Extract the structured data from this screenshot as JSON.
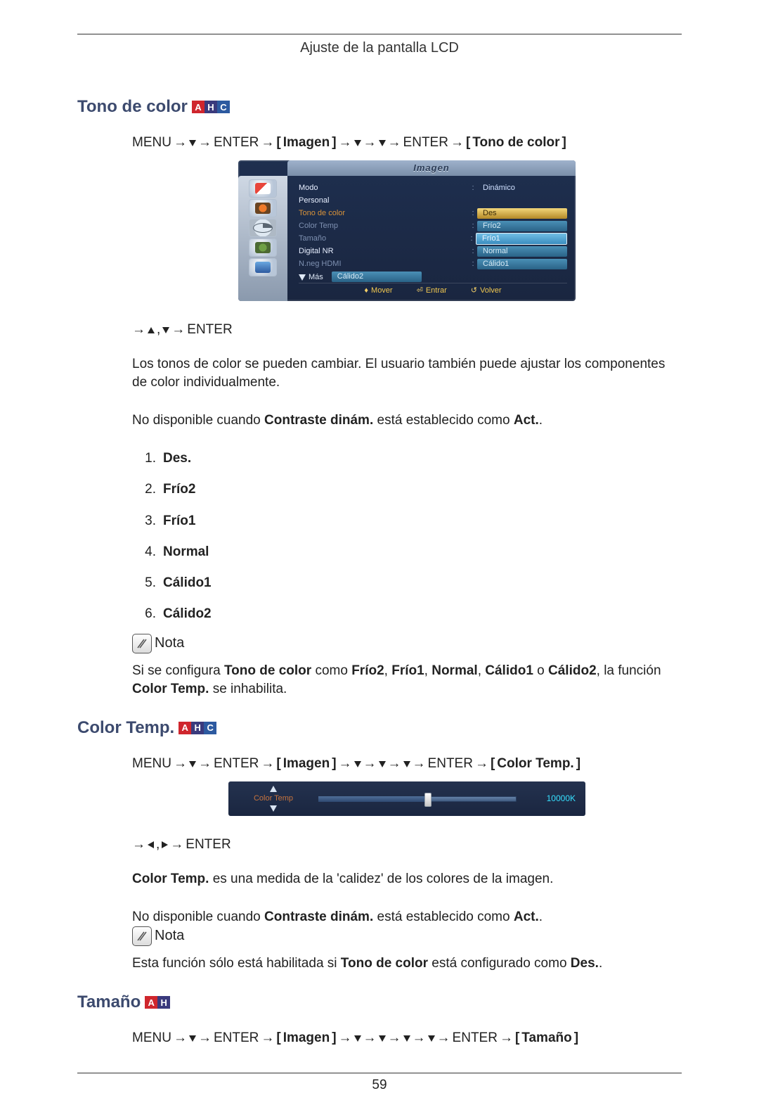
{
  "header": {
    "title": "Ajuste de la pantalla LCD"
  },
  "page_number": "59",
  "badges": {
    "a": "A",
    "h": "H",
    "c": "C"
  },
  "sec_tono": {
    "heading": "Tono de color",
    "menu": {
      "menu": "MENU",
      "enter": "ENTER",
      "imagen": "Imagen",
      "target": "Tono de color"
    },
    "osd": {
      "title": "Imagen",
      "rows": {
        "modo": {
          "label": "Modo",
          "value": "Dinámico"
        },
        "personal": {
          "label": "Personal"
        },
        "tono": {
          "label": "Tono de color",
          "value": "Des"
        },
        "ctemp": {
          "label": "Color Temp",
          "value": "Frío2"
        },
        "tam": {
          "label": "Tamaño",
          "value": "Frío1"
        },
        "dnr": {
          "label": "Digital NR",
          "value": "Normal"
        },
        "nhdmi": {
          "label": "N.neg HDMI",
          "value": "Cálido1"
        }
      },
      "extra_cal2": "Cálido2",
      "more": "Más",
      "footer": {
        "mover": "Mover",
        "entrar": "Entrar",
        "volver": "Volver"
      }
    },
    "nav_enter": "ENTER",
    "para1": "Los tonos de color se pueden cambiar. El usuario también puede ajustar los componentes de color individualmente.",
    "para2_pre": "No disponible cuando ",
    "para2_b1": "Contraste dinám.",
    "para2_mid": " está establecido como ",
    "para2_b2": "Act.",
    "para2_post": ".",
    "options": [
      "Des.",
      "Frío2",
      "Frío1",
      "Normal",
      "Cálido1",
      "Cálido2"
    ],
    "nota_label": "Nota",
    "nota_pre": "Si se configura ",
    "nota_b1": "Tono de color",
    "nota_mid1": " como ",
    "nota_b2": "Frío2",
    "nota_c1": ", ",
    "nota_b3": "Frío1",
    "nota_c2": ", ",
    "nota_b4": "Normal",
    "nota_c3": ", ",
    "nota_b5": "Cálido1",
    "nota_c4": " o ",
    "nota_b6": "Cálido2",
    "nota_mid2": ", la función ",
    "nota_b7": "Color Temp.",
    "nota_post": " se inhabilita."
  },
  "sec_ctemp": {
    "heading": "Color Temp.",
    "menu": {
      "menu": "MENU",
      "enter": "ENTER",
      "imagen": "Imagen",
      "target": "Color Temp."
    },
    "slider": {
      "label": "Color Temp",
      "value": "10000K",
      "pos_percent": 55
    },
    "nav_enter": "ENTER",
    "para1_b": "Color Temp.",
    "para1_post": " es una medida de la 'calidez' de los colores de la imagen.",
    "para2_pre": "No disponible cuando ",
    "para2_b1": "Contraste dinám.",
    "para2_mid": " está establecido como ",
    "para2_b2": "Act.",
    "para2_post": ".",
    "nota_label": "Nota",
    "nota2_pre": "Esta función sólo está habilitada si ",
    "nota2_b1": "Tono de color",
    "nota2_mid": " está configurado como ",
    "nota2_b2": "Des.",
    "nota2_post": "."
  },
  "sec_tam": {
    "heading": "Tamaño",
    "menu": {
      "menu": "MENU",
      "enter": "ENTER",
      "imagen": "Imagen",
      "target": "Tamaño"
    }
  }
}
